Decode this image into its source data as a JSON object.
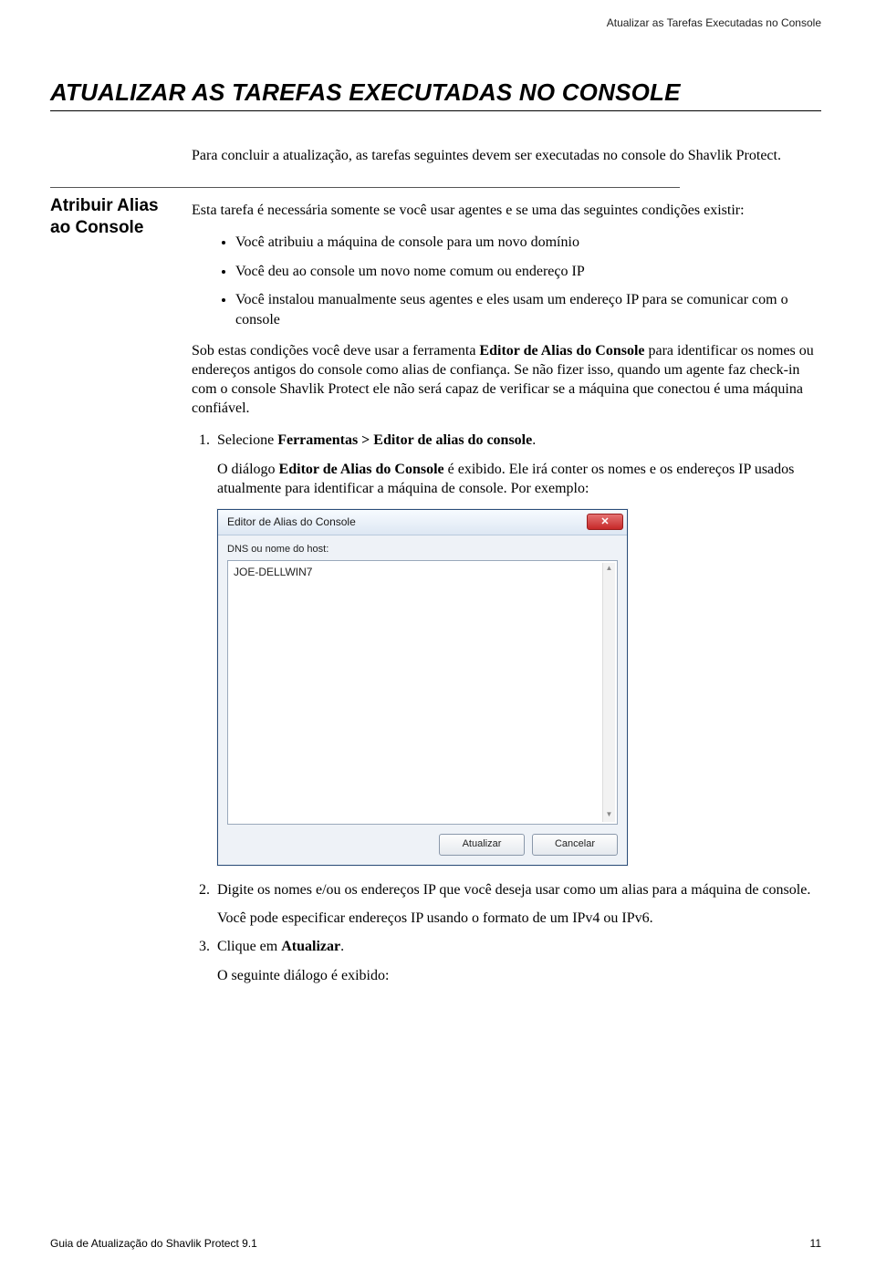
{
  "header": {
    "running": "Atualizar as Tarefas Executadas no Console"
  },
  "title": {
    "main": "ATUALIZAR AS TAREFAS EXECUTADAS NO CONSOLE"
  },
  "sidebar": {
    "heading_line1": "Atribuir Alias",
    "heading_line2": "ao Console"
  },
  "intro": {
    "p1": "Para concluir a atualização, as tarefas seguintes devem ser executadas no console do Shavlik Protect.",
    "p2": "Esta tarefa é necessária somente se você usar agentes e se uma das seguintes condições existir:"
  },
  "bullets": [
    "Você atribuiu a máquina de console para um novo domínio",
    "Você deu ao console um novo nome comum ou endereço IP",
    "Você instalou manualmente seus agentes e eles usam um endereço IP para se comunicar com o console"
  ],
  "body": {
    "sob_pre": "Sob estas condições você deve usar a ferramenta ",
    "sob_bold": "Editor de Alias do Console",
    "sob_post": " para identificar os nomes ou endereços antigos do console como alias de confiança. Se não fizer isso, quando um agente faz check-in com o console Shavlik Protect ele não será capaz de verificar se a máquina que conectou é uma máquina confiável."
  },
  "steps": {
    "s1_pre": "Selecione ",
    "s1_bold": "Ferramentas > Editor de alias do console",
    "s1_post": ".",
    "s1_sub_pre": "O diálogo ",
    "s1_sub_bold": "Editor de Alias do Console",
    "s1_sub_post": " é exibido. Ele irá conter os nomes e os endereços IP usados atualmente para identificar a máquina de console. Por exemplo:",
    "s2": "Digite os nomes e/ou os endereços IP que você deseja usar como um alias para a máquina de console.",
    "s2_sub": "Você pode especificar endereços IP usando o formato de um IPv4 ou IPv6.",
    "s3_pre": "Clique em ",
    "s3_bold": "Atualizar",
    "s3_post": ".",
    "s3_sub": "O seguinte diálogo é exibido:"
  },
  "dialog": {
    "title": "Editor de Alias do Console",
    "label": "DNS ou nome do host:",
    "value": "JOE-DELLWIN7",
    "btn_update": "Atualizar",
    "btn_cancel": "Cancelar"
  },
  "footer": {
    "left": "Guia de Atualização do Shavlik Protect 9.1",
    "right": "11"
  }
}
